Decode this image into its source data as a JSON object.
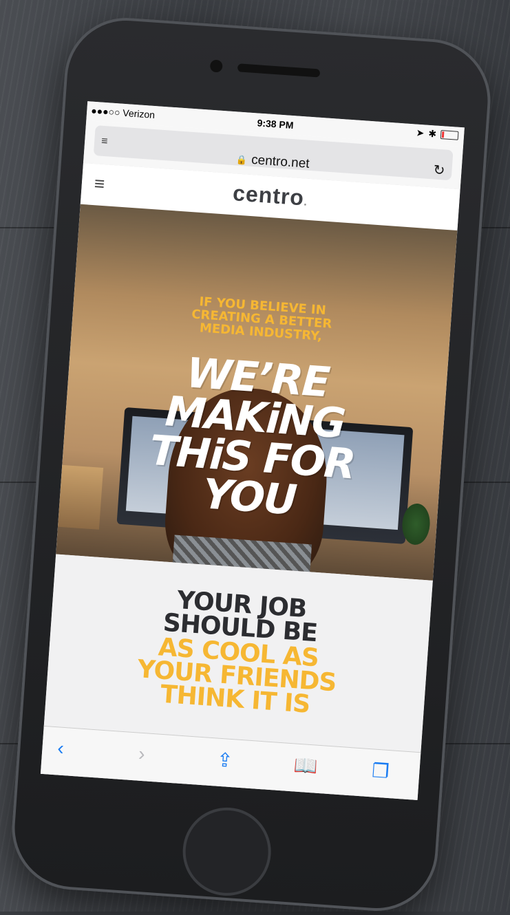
{
  "status": {
    "carrier": "●●●○○ Verizon",
    "wifi_icon": "wifi-icon",
    "time": "9:38 PM",
    "location_icon": "➤",
    "bluetooth_icon": "✱"
  },
  "browser": {
    "reader_icon": "≡",
    "lock_icon": "🔒",
    "url": "centro.net",
    "reload_icon": "↻"
  },
  "site": {
    "menu_icon": "≡",
    "logo": "centro",
    "logo_mark": "."
  },
  "hero": {
    "kicker_lines": [
      "IF YOU BELIEVE IN",
      "CREATING A BETTER",
      "MEDIA INDUSTRY,"
    ],
    "headline_lines": [
      "WE’RE",
      "MAKiNG",
      "THiS FOR",
      "YOU"
    ]
  },
  "job": {
    "dark_lines": [
      "YOUR JOB",
      "SHOULD BE"
    ],
    "accent_lines": [
      "AS COOL AS",
      "YOUR FRIENDS",
      "THINK IT IS"
    ],
    "accent_color": "#f6b733"
  },
  "toolbar": {
    "back": "‹",
    "forward": "›",
    "share": "⇪",
    "bookmarks": "📖",
    "tabs": "❐"
  }
}
